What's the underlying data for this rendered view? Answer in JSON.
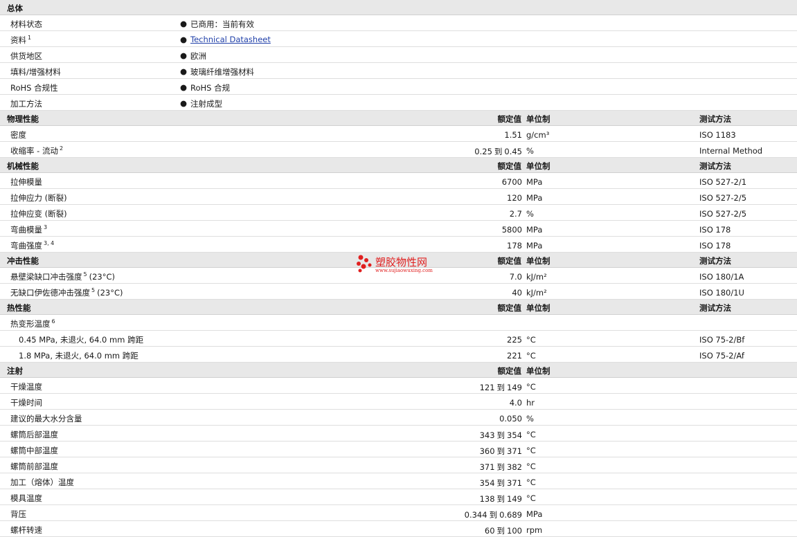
{
  "sections": [
    {
      "title": "总体",
      "kind": "general",
      "rows": [
        {
          "label": "材料状态",
          "sup": "",
          "value": "已商用：当前有效",
          "link": false
        },
        {
          "label": "资料",
          "sup": "1",
          "value": "Technical Datasheet",
          "link": true
        },
        {
          "label": "供货地区",
          "sup": "",
          "value": "欧洲",
          "link": false
        },
        {
          "label": "填料/增强材料",
          "sup": "",
          "value": "玻璃纤维增强材料",
          "link": false
        },
        {
          "label": "RoHS 合规性",
          "sup": "",
          "value": "RoHS 合规",
          "link": false
        },
        {
          "label": "加工方法",
          "sup": "",
          "value": "注射成型",
          "link": false
        }
      ]
    },
    {
      "title": "物理性能",
      "kind": "prop",
      "hdr": {
        "value": "额定值",
        "unit": "单位制",
        "method": "测试方法"
      },
      "rows": [
        {
          "label": "密度",
          "sup": "",
          "v1": "1.51",
          "v2": "",
          "unit": "g/cm³",
          "method": "ISO 1183"
        },
        {
          "label": "收缩率 - 流动",
          "sup": "2",
          "v1": "0.25",
          "v2": "0.45",
          "unit": "%",
          "method": "Internal Method"
        }
      ]
    },
    {
      "title": "机械性能",
      "kind": "prop",
      "hdr": {
        "value": "额定值",
        "unit": "单位制",
        "method": "测试方法"
      },
      "rows": [
        {
          "label": "拉伸模量",
          "sup": "",
          "v1": "6700",
          "v2": "",
          "unit": "MPa",
          "method": "ISO 527-2/1"
        },
        {
          "label": "拉伸应力 (断裂)",
          "sup": "",
          "v1": "120",
          "v2": "",
          "unit": "MPa",
          "method": "ISO 527-2/5"
        },
        {
          "label": "拉伸应变 (断裂)",
          "sup": "",
          "v1": "2.7",
          "v2": "",
          "unit": "%",
          "method": "ISO 527-2/5"
        },
        {
          "label": "弯曲模量",
          "sup": "3",
          "v1": "5800",
          "v2": "",
          "unit": "MPa",
          "method": "ISO 178"
        },
        {
          "label": "弯曲强度",
          "sup": "3, 4",
          "v1": "178",
          "v2": "",
          "unit": "MPa",
          "method": "ISO 178"
        }
      ]
    },
    {
      "title": "冲击性能",
      "kind": "prop",
      "hdr": {
        "value": "额定值",
        "unit": "单位制",
        "method": "测试方法"
      },
      "rows": [
        {
          "label": "悬壁梁缺口冲击强度",
          "sup": "5",
          "suffix": "(23°C)",
          "v1": "7.0",
          "v2": "",
          "unit": "kJ/m²",
          "method": "ISO 180/1A"
        },
        {
          "label": "无缺口伊佐德冲击强度",
          "sup": "5",
          "suffix": "(23°C)",
          "v1": "40",
          "v2": "",
          "unit": "kJ/m²",
          "method": "ISO 180/1U"
        }
      ]
    },
    {
      "title": "热性能",
      "kind": "prop",
      "hdr": {
        "value": "额定值",
        "unit": "单位制",
        "method": "测试方法"
      },
      "rows": [
        {
          "label": "热变形温度",
          "sup": "6",
          "v1": "",
          "v2": "",
          "unit": "",
          "method": ""
        },
        {
          "label": "0.45 MPa, 未退火, 64.0 mm 跨距",
          "sup": "",
          "indent": true,
          "v1": "225",
          "v2": "",
          "unit": "°C",
          "method": "ISO 75-2/Bf"
        },
        {
          "label": "1.8 MPa, 未退火, 64.0 mm 跨距",
          "sup": "",
          "indent": true,
          "v1": "221",
          "v2": "",
          "unit": "°C",
          "method": "ISO 75-2/Af"
        }
      ]
    },
    {
      "title": "注射",
      "kind": "prop",
      "hdr": {
        "value": "额定值",
        "unit": "单位制",
        "method": ""
      },
      "rows": [
        {
          "label": "干燥温度",
          "sup": "",
          "v1": "121",
          "v2": "149",
          "unit": "°C",
          "method": ""
        },
        {
          "label": "干燥时间",
          "sup": "",
          "v1": "4.0",
          "v2": "",
          "unit": "hr",
          "method": ""
        },
        {
          "label": "建议的最大水分含量",
          "sup": "",
          "v1": "0.050",
          "v2": "",
          "unit": "%",
          "method": ""
        },
        {
          "label": "螺筒后部温度",
          "sup": "",
          "v1": "343",
          "v2": "354",
          "unit": "°C",
          "method": ""
        },
        {
          "label": "螺筒中部温度",
          "sup": "",
          "v1": "360",
          "v2": "371",
          "unit": "°C",
          "method": ""
        },
        {
          "label": "螺筒前部温度",
          "sup": "",
          "v1": "371",
          "v2": "382",
          "unit": "°C",
          "method": ""
        },
        {
          "label": "加工（熔体）温度",
          "sup": "",
          "v1": "354",
          "v2": "371",
          "unit": "°C",
          "method": ""
        },
        {
          "label": "模具温度",
          "sup": "",
          "v1": "138",
          "v2": "149",
          "unit": "°C",
          "method": ""
        },
        {
          "label": "背压",
          "sup": "",
          "v1": "0.344",
          "v2": "0.689",
          "unit": "MPa",
          "method": ""
        },
        {
          "label": "螺杆转速",
          "sup": "",
          "v1": "60",
          "v2": "100",
          "unit": "rpm",
          "method": ""
        }
      ]
    }
  ],
  "range_word": "到",
  "bullet_char": "●",
  "watermark": {
    "name": "塑胶物性网",
    "url": "www.sujiaowuxing.com",
    "color": "#e02020"
  }
}
